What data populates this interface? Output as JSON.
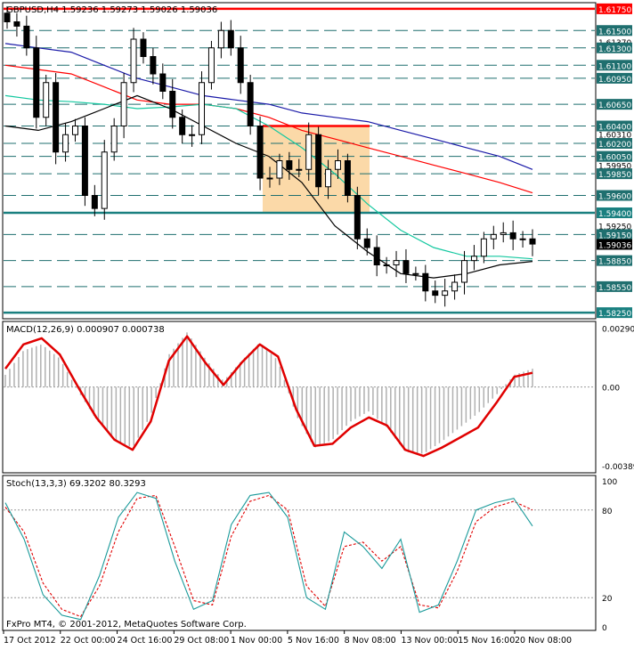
{
  "chart_data": [
    {
      "type": "candlestick",
      "panel": "price",
      "title": "GBPUSD,H4  1.59236 1.59273 1.59026 1.59036",
      "y_range": [
        1.582,
        1.618
      ],
      "x_ticks": [
        "17 Oct 2012",
        "22 Oct 00:00",
        "24 Oct 16:00",
        "29 Oct 08:00",
        "1 Nov 00:00",
        "5 Nov 16:00",
        "8 Nov 08:00",
        "13 Nov 00:00",
        "15 Nov 16:00",
        "20 Nov 08:00"
      ],
      "price_labels": [
        "1.61750",
        "1.61500",
        "1.61370",
        "1.61300",
        "1.61100",
        "1.60950",
        "1.60650",
        "1.60400",
        "1.60310",
        "1.60200",
        "1.60050",
        "1.59950",
        "1.59850",
        "1.59600",
        "1.59400",
        "1.59250",
        "1.59150",
        "1.59036",
        "1.58850",
        "1.58550",
        "1.58250"
      ],
      "current_price": "1.59036",
      "levels": {
        "red": [
          1.6175
        ],
        "teal": [
          1.594,
          1.5825
        ],
        "dashed": [
          1.615,
          1.613,
          1.611,
          1.6095,
          1.6065,
          1.604,
          1.602,
          1.6005,
          1.5985,
          1.596,
          1.5915,
          1.5885,
          1.5855
        ]
      },
      "zone": {
        "top": 1.604,
        "bottom": 1.594
      },
      "close_path": [
        1.616,
        1.6155,
        1.613,
        1.605,
        1.609,
        1.601,
        1.603,
        1.604,
        1.596,
        1.5945,
        1.601,
        1.604,
        1.609,
        1.614,
        1.612,
        1.61,
        1.608,
        1.605,
        1.603,
        1.603,
        1.609,
        1.613,
        1.615,
        1.613,
        1.609,
        1.604,
        1.598,
        1.598,
        1.6,
        1.599,
        1.599,
        1.603,
        1.597,
        1.599,
        1.6,
        1.596,
        1.591,
        1.59,
        1.588,
        1.588,
        1.5885,
        1.587,
        1.587,
        1.585,
        1.5845,
        1.585,
        1.586,
        1.5885,
        1.589,
        1.591,
        1.5915,
        1.5917,
        1.591,
        1.591,
        1.5904
      ],
      "series": [
        {
          "color": "#ff0000",
          "values": [
            1.611,
            1.6105,
            1.61,
            1.6085,
            1.607,
            1.6065,
            1.6065,
            1.606,
            1.605,
            1.6035,
            1.6025,
            1.6015,
            1.6005,
            1.5995,
            1.5985,
            1.5975,
            1.5963
          ]
        },
        {
          "color": "#1a1aa8",
          "values": [
            1.6135,
            1.613,
            1.6125,
            1.611,
            1.6095,
            1.6085,
            1.6075,
            1.607,
            1.6065,
            1.6055,
            1.605,
            1.6045,
            1.6035,
            1.6025,
            1.6015,
            1.6005,
            1.599
          ]
        },
        {
          "color": "#14c8a0",
          "values": [
            1.6075,
            1.607,
            1.6068,
            1.6065,
            1.606,
            1.6062,
            1.6065,
            1.606,
            1.604,
            1.6015,
            1.5985,
            1.595,
            1.592,
            1.59,
            1.589,
            1.589,
            1.5887
          ]
        },
        {
          "color": "#000000",
          "values": [
            1.604,
            1.6035,
            1.6045,
            1.606,
            1.6075,
            1.606,
            1.604,
            1.602,
            1.6005,
            1.5975,
            1.5925,
            1.5895,
            1.587,
            1.5865,
            1.587,
            1.588,
            1.5884
          ]
        }
      ]
    },
    {
      "type": "line",
      "panel": "macd",
      "title": "MACD(12,26,9) 0.000907 0.000738",
      "y_range": [
        -0.0041,
        0.0031
      ],
      "y_ticks": [
        "0.00290",
        "0.00",
        "-0.00389"
      ],
      "signal_line": [
        0.0009,
        0.0021,
        0.0024,
        0.0016,
        0.0,
        -0.0015,
        -0.0026,
        -0.0031,
        -0.0017,
        0.0013,
        0.0025,
        0.0012,
        0.0001,
        0.0012,
        0.0021,
        0.0015,
        -0.0011,
        -0.0029,
        -0.0028,
        -0.002,
        -0.0015,
        -0.0019,
        -0.0031,
        -0.0034,
        -0.003,
        -0.0025,
        -0.002,
        -0.0008,
        0.0005,
        0.0007
      ],
      "histogram": [
        0.0006,
        0.0018,
        0.0021,
        0.0014,
        -0.0002,
        -0.0016,
        -0.0026,
        -0.003,
        -0.0014,
        0.0016,
        0.0027,
        0.0014,
        0.0003,
        0.0013,
        0.0022,
        0.0013,
        -0.0014,
        -0.003,
        -0.0026,
        -0.0017,
        -0.0012,
        -0.002,
        -0.0032,
        -0.0033,
        -0.0027,
        -0.002,
        -0.0013,
        -0.0004,
        0.0006,
        0.0009
      ]
    },
    {
      "type": "line",
      "panel": "stochastic",
      "title": "Stoch(13,3,3) 69.3202 80.3293",
      "y_range": [
        0,
        100
      ],
      "y_ticks": [
        "100",
        "80",
        "20",
        "0"
      ],
      "main": [
        85,
        60,
        22,
        8,
        5,
        35,
        75,
        92,
        88,
        45,
        12,
        18,
        70,
        90,
        92,
        75,
        20,
        12,
        65,
        55,
        40,
        60,
        10,
        15,
        45,
        80,
        85,
        88,
        69
      ],
      "signal": [
        82,
        65,
        30,
        12,
        7,
        28,
        65,
        88,
        90,
        55,
        18,
        15,
        62,
        86,
        90,
        80,
        28,
        14,
        55,
        58,
        45,
        55,
        15,
        13,
        38,
        72,
        82,
        86,
        80
      ]
    }
  ],
  "footer": {
    "copyright": "FxPro MT4, © 2001-2012, MetaQuotes Software Corp."
  }
}
